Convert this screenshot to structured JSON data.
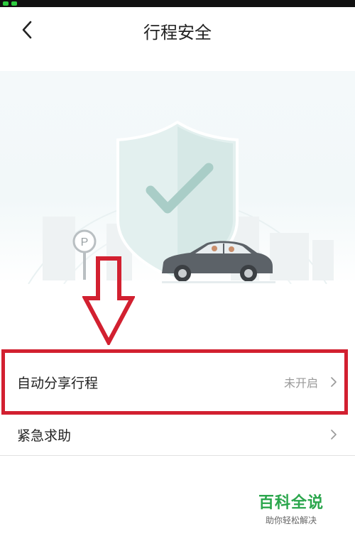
{
  "header": {
    "title": "行程安全"
  },
  "settings": {
    "auto_share": {
      "label": "自动分享行程",
      "value": "未开启"
    },
    "emergency": {
      "label": "紧急求助"
    }
  },
  "hero": {
    "parking_sign": "P"
  },
  "watermark": {
    "title": "百科全说",
    "subtitle": "助你轻松解决"
  },
  "colors": {
    "highlight": "#d22030",
    "watermark_green": "#2aa64c",
    "shield": "#dfeeed",
    "check": "#a7ccc6"
  },
  "icons": {
    "back": "chevron-left-icon",
    "chevron": "chevron-right-icon",
    "shield": "shield-check-icon",
    "car": "car-icon",
    "parking": "parking-sign-icon",
    "arrow": "down-arrow-annotation"
  }
}
